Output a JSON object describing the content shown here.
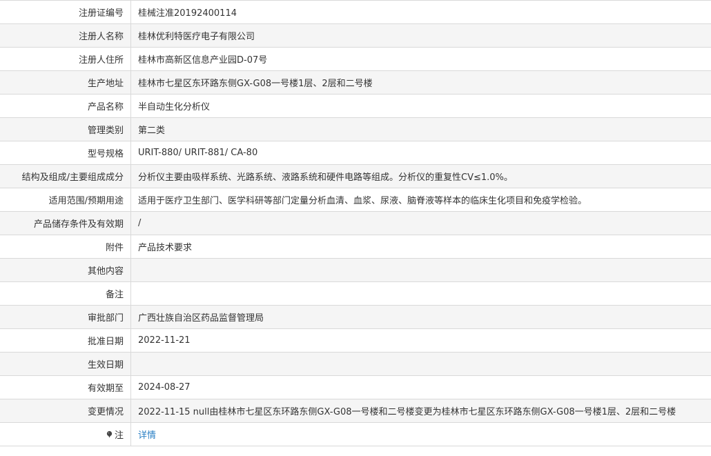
{
  "colors": {
    "border": "#d9d9d9",
    "row_alt_bg": "#f5f5f5",
    "text": "#333333",
    "link": "#2a7fc4"
  },
  "rows": [
    {
      "label": "注册证编号",
      "value": "桂械注准20192400114"
    },
    {
      "label": "注册人名称",
      "value": "桂林优利特医疗电子有限公司"
    },
    {
      "label": "注册人住所",
      "value": "桂林市高新区信息产业园D-07号"
    },
    {
      "label": "生产地址",
      "value": "桂林市七星区东环路东侧GX-G08一号楼1层、2层和二号楼"
    },
    {
      "label": "产品名称",
      "value": "半自动生化分析仪"
    },
    {
      "label": "管理类别",
      "value": "第二类"
    },
    {
      "label": "型号规格",
      "value": "URIT-880/ URIT-881/ CA-80"
    },
    {
      "label": "结构及组成/主要组成成分",
      "value": "分析仪主要由吸样系统、光路系统、液路系统和硬件电路等组成。分析仪的重复性CV≤1.0%。"
    },
    {
      "label": "适用范围/预期用途",
      "value": "适用于医疗卫生部门、医学科研等部门定量分析血清、血浆、尿液、脑脊液等样本的临床生化项目和免疫学检验。"
    },
    {
      "label": "产品储存条件及有效期",
      "value": "/"
    },
    {
      "label": "附件",
      "value": "产品技术要求"
    },
    {
      "label": "其他内容",
      "value": ""
    },
    {
      "label": "备注",
      "value": ""
    },
    {
      "label": "审批部门",
      "value": "广西壮族自治区药品监督管理局"
    },
    {
      "label": "批准日期",
      "value": "2022-11-21"
    },
    {
      "label": "生效日期",
      "value": ""
    },
    {
      "label": "有效期至",
      "value": "2024-08-27"
    },
    {
      "label": "变更情况",
      "value": "2022-11-15 null由桂林市七星区东环路东侧GX-G08一号楼和二号楼变更为桂林市七星区东环路东侧GX-G08一号楼1层、2层和二号楼"
    }
  ],
  "note_row": {
    "label": "注",
    "icon": "pin-icon",
    "link_text": "详情"
  }
}
